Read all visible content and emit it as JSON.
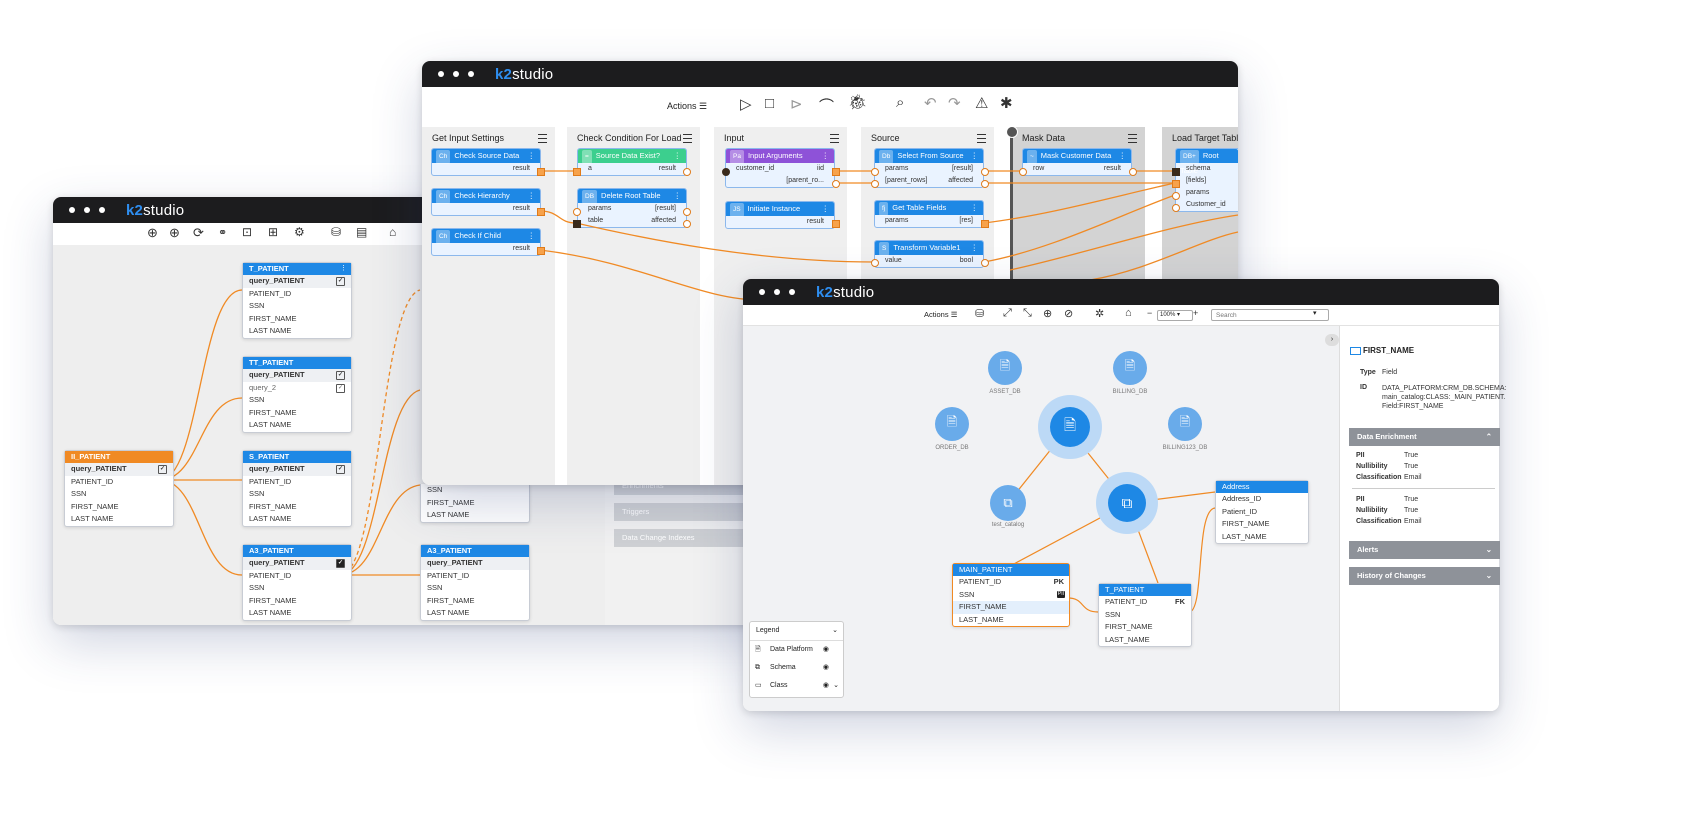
{
  "brand": {
    "prefix": "k2",
    "suffix": "studio"
  },
  "left_window": {
    "entities": [
      {
        "title": "T_PATIENT",
        "rows": [
          "query_PATIENT",
          "PATIENT_ID",
          "SSN",
          "FIRST_NAME",
          "LAST NAME"
        ]
      },
      {
        "title": "TT_PATIENT",
        "rows": [
          "query_PATIENT",
          "query_2",
          "SSN",
          "FIRST_NAME",
          "LAST NAME"
        ]
      },
      {
        "title": "S_PATIENT",
        "rows": [
          "query_PATIENT",
          "PATIENT_ID",
          "SSN",
          "FIRST_NAME",
          "LAST NAME"
        ]
      },
      {
        "title": "A3_PATIENT",
        "rows": [
          "query_PATIENT",
          "PATIENT_ID",
          "SSN",
          "FIRST_NAME",
          "LAST NAME"
        ]
      },
      {
        "title": "A3_PATIENT",
        "rows": [
          "query_PATIENT",
          "PATIENT_ID",
          "SSN",
          "FIRST_NAME",
          "LAST NAME"
        ]
      },
      {
        "title": "II_PATIENT",
        "rows": [
          "query_PATIENT",
          "PATIENT_ID",
          "SSN",
          "FIRST_NAME",
          "LAST NAME"
        ]
      }
    ],
    "partial_rows": [
      "SSN",
      "FIRST_NAME",
      "LAST NAME"
    ],
    "gray_items": [
      "Enrichments",
      "Triggers",
      "Data Change Indexes"
    ]
  },
  "flow_window": {
    "actions_label": "Actions",
    "columns": [
      {
        "title": "Get Input Settings"
      },
      {
        "title": "Check Condition For Load"
      },
      {
        "title": "Input"
      },
      {
        "title": "Source"
      },
      {
        "title": "Mask Data"
      },
      {
        "title": "Load Target Table"
      }
    ],
    "blocks": {
      "check_source": {
        "tag": "Ch",
        "title": "Check Source Data",
        "out": "result"
      },
      "check_hierarchy": {
        "tag": "Ch",
        "title": "Check Hierarchy",
        "out": "result"
      },
      "check_child": {
        "tag": "Ch",
        "title": "Check If Child",
        "out": "result"
      },
      "source_exist": {
        "tag": "=",
        "title": "Source Data Exist?",
        "in": "a",
        "out": "result"
      },
      "delete_root": {
        "tag": "DB",
        "title": "Delete Root Table",
        "in1": "params",
        "out1": "[result]",
        "in2": "table",
        "out2": "affected"
      },
      "input_args": {
        "tag": "Pa",
        "title": "Input Arguments",
        "in": "customer_id",
        "out1": "iid",
        "out2": "[parent_ro..."
      },
      "initiate": {
        "tag": "JS",
        "title": "Initiate Instance",
        "out": "result"
      },
      "select_source": {
        "tag": "Db",
        "title": "Select From Source",
        "in1": "params",
        "out1": "[result]",
        "in2": "[parent_rows]",
        "out2": "affected"
      },
      "get_fields": {
        "tag": "fj",
        "title": "Get Table Fields",
        "in": "params",
        "out": "[res]"
      },
      "transform": {
        "tag": "S",
        "title": "Transform Variable1",
        "in": "value",
        "out": "bool"
      },
      "mask_customer": {
        "tag": "~",
        "title": "Mask Customer Data",
        "in": "row",
        "out": "result"
      },
      "root_table": {
        "tag": "DB+",
        "title": "Root Table",
        "rows": [
          "schema",
          "[fields]",
          "params",
          "Customer_id"
        ]
      }
    }
  },
  "catalog_window": {
    "actions_label": "Actions",
    "zoom": "100%",
    "search_placeholder": "Search",
    "nodes": {
      "asset": "ASSET_DB",
      "billing": "BILLING_DB",
      "order": "ORDER_DB",
      "billing123": "BILLING123_DB",
      "test_catalog": "test_catalog"
    },
    "main_patient": {
      "title": "MAIN_PATIENT",
      "rows": [
        "PATIENT_ID",
        "SSN",
        "FIRST_NAME",
        "LAST_NAME"
      ],
      "pk": "PK",
      "pii": "PII"
    },
    "t_patient": {
      "title": "T_PATIENT",
      "rows": [
        "PATIENT_ID",
        "SSN",
        "FIRST_NAME",
        "LAST_NAME"
      ],
      "fk": "FK"
    },
    "address": {
      "title": "Address",
      "rows": [
        "Address_ID",
        "Patient_ID",
        "FIRST_NAME",
        "LAST_NAME"
      ]
    },
    "legend": {
      "title": "Legend",
      "items": [
        "Data Platform",
        "Schema",
        "Class"
      ]
    },
    "panel": {
      "title": "FIRST_NAME",
      "type_key": "Type",
      "type_val": "Field",
      "id_key": "ID",
      "id_lines": [
        "DATA_PLATFORM:CRM_DB.SCHEMA:",
        "main_catalog:CLASS:_MAIN_PATIENT.",
        "Field:FIRST_NAME"
      ],
      "enrichment_title": "Data Enrichment",
      "enrichment_groups": [
        [
          [
            "PII",
            "True"
          ],
          [
            "Nullibility",
            "True"
          ],
          [
            "Classification",
            "Email"
          ]
        ],
        [
          [
            "PII",
            "True"
          ],
          [
            "Nullibility",
            "True"
          ],
          [
            "Classification",
            "Email"
          ]
        ]
      ],
      "alerts_title": "Alerts",
      "history_title": "History of Changes"
    }
  }
}
